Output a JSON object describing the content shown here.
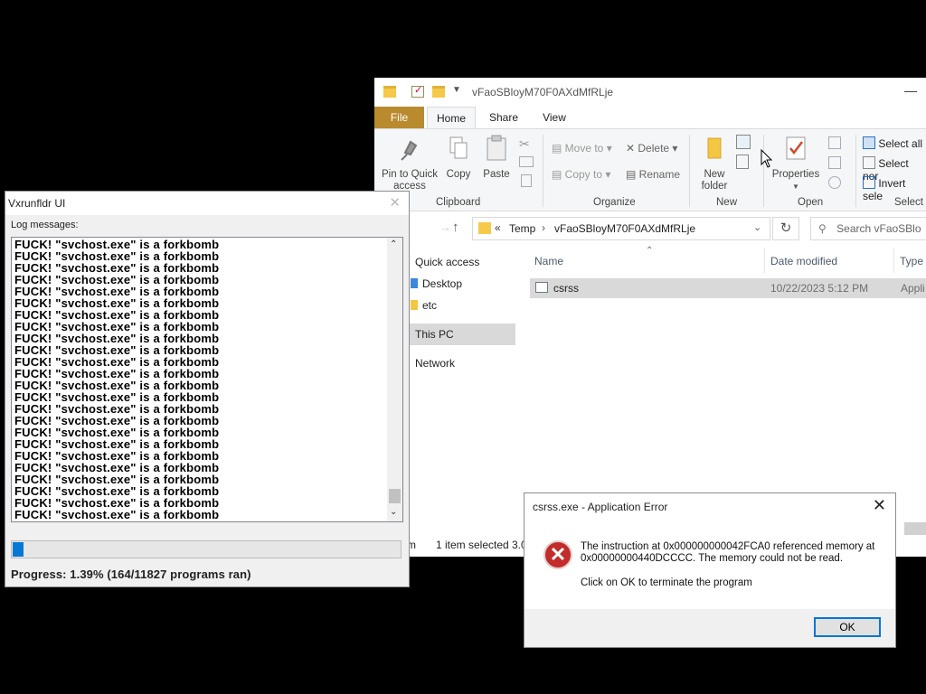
{
  "explorer": {
    "title": "vFaoSBloyM70F0AXdMfRLje",
    "tabs": [
      "File",
      "Home",
      "Share",
      "View"
    ],
    "clipboard": {
      "pin_label": "Pin to Quick access",
      "copy_label": "Copy",
      "paste_label": "Paste",
      "group_label": "Clipboard"
    },
    "organize": {
      "move_to": "Move to",
      "copy_to": "Copy to",
      "delete": "Delete",
      "rename": "Rename",
      "group_label": "Organize"
    },
    "new": {
      "new_folder": "New folder",
      "group_label": "New"
    },
    "open": {
      "properties": "Properties",
      "group_label": "Open"
    },
    "select": {
      "select_all": "Select all",
      "select_none": "Select nor",
      "invert": "Invert sele",
      "group_label": "Select"
    },
    "address": {
      "chevron": "«",
      "crumb1": "Temp",
      "sep": "›",
      "crumb2": "vFaoSBloyM70F0AXdMfRLje"
    },
    "search_placeholder": "Search vFaoSBlo",
    "nav": {
      "quick_access": "Quick access",
      "desktop": "Desktop",
      "etc": "etc",
      "this_pc": "This PC",
      "network": "Network"
    },
    "columns": {
      "name": "Name",
      "date": "Date modified",
      "type": "Type"
    },
    "file": {
      "name": "csrss",
      "date": "10/22/2023 5:12 PM",
      "type": "Appli"
    },
    "status": {
      "items_fragment": "m",
      "selected": "1 item selected",
      "size_fragment": "3.0"
    }
  },
  "vx": {
    "title": "Vxrunfldr UI",
    "log_label": "Log messages:",
    "log_line": "FUCK! \"svchost.exe\" is a forkbomb",
    "log_count": 24,
    "progress_fraction": 0.0139,
    "progress_text": "Progress: 1.39% (164/11827 programs ran)"
  },
  "dialog": {
    "title": "csrss.exe - Application Error",
    "message": "The instruction at 0x000000000042FCA0 referenced memory at 0x00000000440DCCCC. The memory could not be read.",
    "message2": "Click on OK to terminate the program",
    "ok": "OK",
    "close_glyph": "✕",
    "error_glyph": "✕"
  },
  "colors": {
    "file_tab": "#b98a2e",
    "progress": "#0678d4",
    "error_red": "#c42b2b",
    "selected_row": "#d9d9d9"
  }
}
